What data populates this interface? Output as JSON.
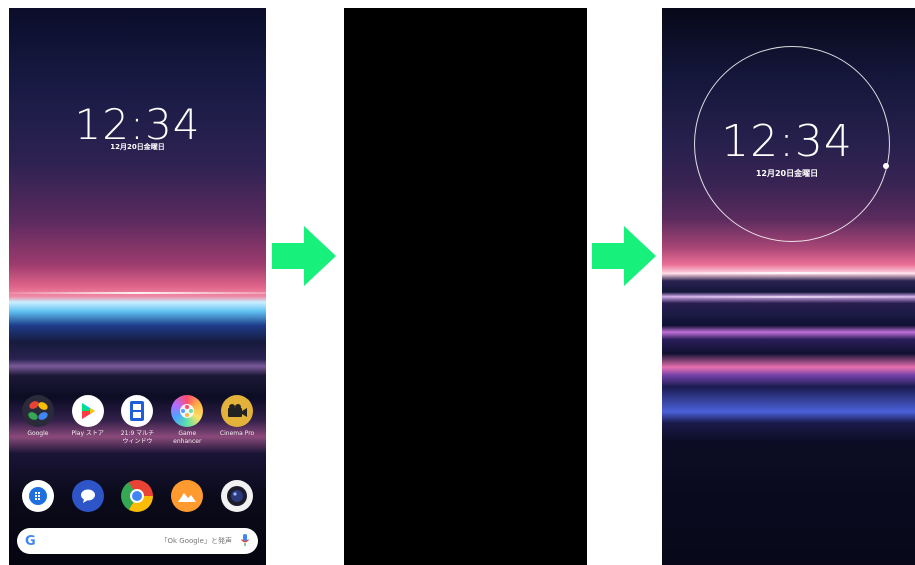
{
  "screens": [
    {
      "name": "home",
      "clock": "12:34",
      "date": "12月20日金曜日",
      "apps": [
        {
          "label": "Google",
          "icon": "google-folder-icon"
        },
        {
          "label": "Play ストア",
          "icon": "play-store-icon"
        },
        {
          "label": "21:9 マルチ\nウィンドウ",
          "icon": "multi-window-icon"
        },
        {
          "label": "Game\nenhancer",
          "icon": "game-enhancer-icon"
        },
        {
          "label": "Cinema Pro",
          "icon": "cinema-pro-icon"
        }
      ],
      "dock": [
        {
          "icon": "phone-icon"
        },
        {
          "icon": "messages-icon"
        },
        {
          "icon": "chrome-icon"
        },
        {
          "icon": "album-icon"
        },
        {
          "icon": "camera-icon"
        }
      ],
      "search_bar": {
        "logo": "G",
        "hint": "「Ok Google」と発声",
        "mic_icon": "mic-icon"
      }
    },
    {
      "name": "screen-off"
    },
    {
      "name": "ambient-display",
      "clock": "12:34",
      "date": "12月20日金曜日"
    }
  ],
  "colors": {
    "arrow": "#17f07a",
    "background": "#ffffff"
  }
}
